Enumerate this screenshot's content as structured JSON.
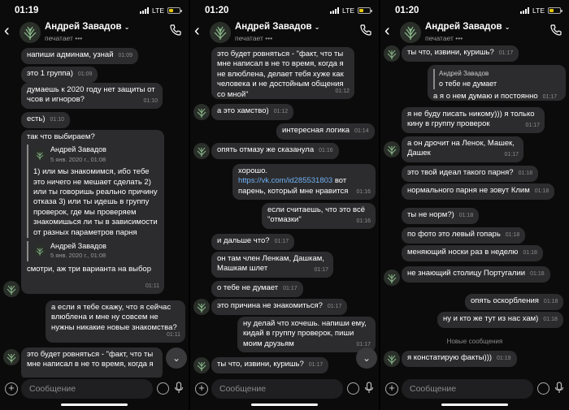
{
  "contact": {
    "name": "Андрей Завадов",
    "status": "печатает",
    "avatar_color": "#2a2f2a"
  },
  "composer": {
    "placeholder": "Сообщение"
  },
  "status_bar": {
    "network": "LTE"
  },
  "panels": [
    {
      "time": "01:19",
      "messages": [
        {
          "text": "напиши админам, узнай",
          "time": "01:09"
        },
        {
          "text": "это 1 группа)",
          "time": "01:09"
        },
        {
          "text": "думаешь к 2020 году нет защиты от чсов и игноров?",
          "time": "01:10"
        },
        {
          "text": "есть)",
          "time": "01:10"
        },
        {
          "text": "так что выбираем?",
          "forwards": [
            {
              "name": "Андрей Завадов",
              "date": "5 янв. 2020 г., 01:08",
              "text": "1) или мы знакомимся, ибо тебе это ничего не мешает сделать 2) или ты говоришь реально причину отказа 3) или ты идешь в группу проверок, где мы проверяем знакомишься ли ты в зависимости от разных параметров парня"
            },
            {
              "name": "Андрей Завадов",
              "date": "5 янв. 2020 г., 01:08",
              "text": ""
            }
          ],
          "after": "смотри, аж три варианта на выбор",
          "time": "01:11"
        },
        {
          "text": "а если я тебе скажу, что я сейчас влюблена и мне ну совсем не нужны никакие новые знакомства?",
          "time": "01:11"
        },
        {
          "text": "это будет ровняться - \"факт, что ты мне написал в не то время, когда я",
          "time": ""
        }
      ]
    },
    {
      "time": "01:20",
      "messages": [
        {
          "text": "это будет ровняться - \"факт, что ты мне написал в не то время, когда я не влюблена, делает тебя хуже как человека и не достойным общения со мной\"",
          "time": "01:12"
        },
        {
          "text": "а это хамство)",
          "time": "01:12"
        },
        {
          "text": "интересная логика",
          "time": "01:14"
        },
        {
          "text": "опять отмазу же сказанула",
          "time": "01:16"
        },
        {
          "text_pre": "хорошо.",
          "link": "https://vk.com/id285531803",
          "text": "вот парень, который мне нравится",
          "time": "01:16"
        },
        {
          "text": "если считаешь, что это всё \"отмазки\"",
          "time": "01:16"
        },
        {
          "text": "и дальше что?",
          "time": "01:17"
        },
        {
          "text": "он там член Ленкам, Дашкам, Машкам шлет",
          "time": "01:17"
        },
        {
          "text": "о тебе не думает",
          "time": "01:17"
        },
        {
          "text": "это причина не знакомиться?",
          "time": "01:17"
        },
        {
          "text": "ну делай что хочешь. напиши ему, кидай в группу проверок, пиши моим друзьям",
          "time": "01:17"
        },
        {
          "text": "ты что, извини, куришь?",
          "time": "01:17"
        }
      ]
    },
    {
      "time": "01:20",
      "messages": [
        {
          "text": "ты что, извини, куришь?",
          "time": "01:17"
        },
        {
          "reply_name": "Андрей Завадов",
          "reply_text": "о тебе не думает",
          "text": "а я о нем думаю и постоянно",
          "time": "01:17"
        },
        {
          "text": "я не буду писать никому))) я только кину в группу проверок",
          "time": "01:17"
        },
        {
          "text": "а он дрочит на Ленок, Машек, Дашек",
          "time": "01:17"
        },
        {
          "text": "это твой идеал такого парня?",
          "time": "01:18"
        },
        {
          "text": "нормального парня не зовут Клим",
          "time": "01:18"
        },
        {
          "text": "ты не норм?)",
          "time": "01:18"
        },
        {
          "text": "по фото это левый гопарь",
          "time": "01:18"
        },
        {
          "text": "меняющий носки раз в неделю",
          "time": "01:18"
        },
        {
          "text": "не знающий столицу Португалии",
          "time": "01:18"
        },
        {
          "text": "опять оскорбления",
          "time": "01:18"
        },
        {
          "text": "ну и кто же тут из нас хам)",
          "time": "01:18"
        },
        {
          "text": "я констатирую факты)))",
          "time": "01:19"
        }
      ],
      "divider": "Новые сообщения"
    }
  ]
}
